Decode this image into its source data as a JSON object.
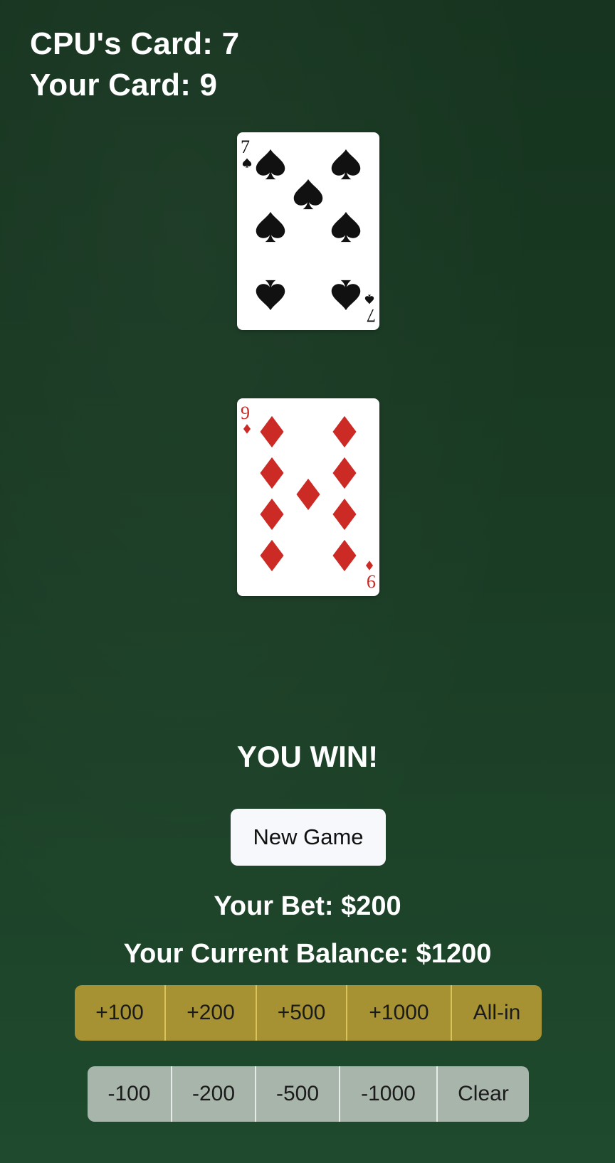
{
  "scoreboard": {
    "cpu_card_text": "CPU's Card: 7",
    "your_card_text": "Your Card: 9"
  },
  "cards": {
    "cpu": {
      "rank": "7",
      "suit": "spades",
      "color": "#111111"
    },
    "player": {
      "rank": "9",
      "suit": "diamonds",
      "color": "#cc2a25"
    }
  },
  "result": {
    "message": "YOU WIN!"
  },
  "controls": {
    "new_game_label": "New Game"
  },
  "status": {
    "bet_text": "Your Bet: $200",
    "balance_text": "Your Current Balance: $1200"
  },
  "bet_buttons": {
    "add": [
      "+100",
      "+200",
      "+500",
      "+1000",
      "All-in"
    ],
    "subtract": [
      "-100",
      "-200",
      "-500",
      "-1000",
      "Clear"
    ]
  },
  "colors": {
    "table_green": "#1a3b24",
    "add_buttons": "#a69133",
    "subtract_buttons": "#a8b5ab",
    "new_game_button": "#f7f8fb"
  }
}
